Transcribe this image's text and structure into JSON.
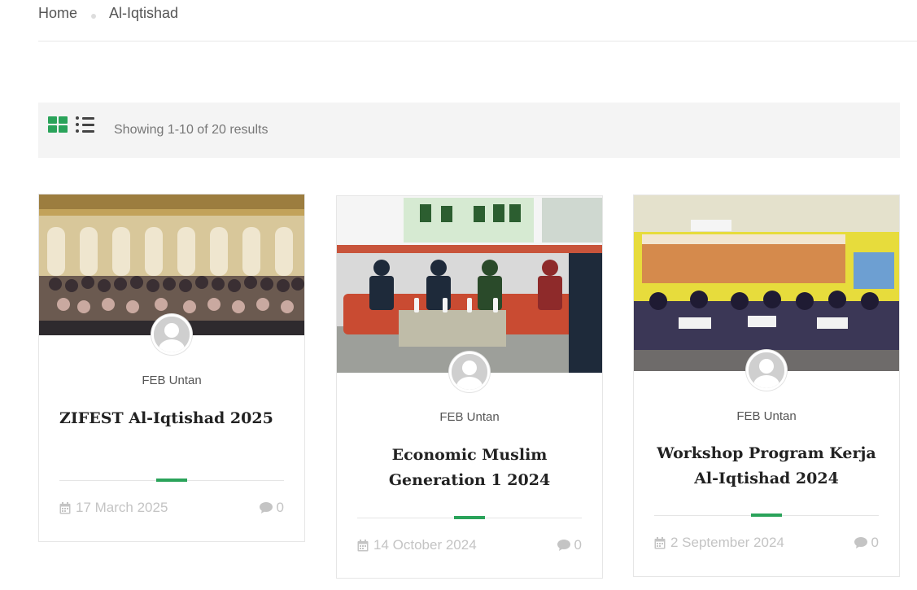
{
  "breadcrumb": {
    "home": "Home",
    "current": "Al-Iqtishad"
  },
  "toolbar": {
    "result_count": "Showing 1-10 of 20 results",
    "grid_view_icon": "grid-icon",
    "list_view_icon": "list-icon"
  },
  "colors": {
    "accent": "#2aa35a",
    "meta_text": "#c4c4c4",
    "toolbar_bg": "#f4f4f4"
  },
  "posts": [
    {
      "author": "FEB Untan",
      "title": "ZIFEST Al-Iqtishad 2025",
      "date": "17 March 2025",
      "comments": "0"
    },
    {
      "author": "FEB Untan",
      "title": "Economic Muslim Generation 1 2024",
      "date": "14 October 2024",
      "comments": "0"
    },
    {
      "author": "FEB Untan",
      "title": "Workshop Program Kerja Al-Iqtishad 2024",
      "date": "2 September 2024",
      "comments": "0"
    }
  ]
}
